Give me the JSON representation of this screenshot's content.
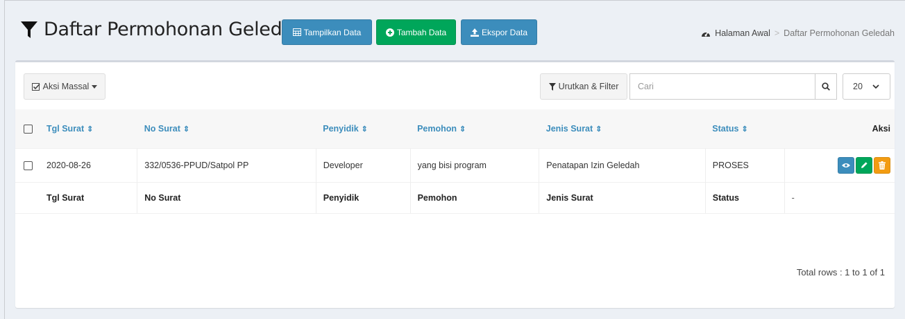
{
  "header": {
    "title": "Daftar Permohonan Geledah",
    "title_icon": "filter-icon",
    "buttons": [
      {
        "label": "Tampilkan Data",
        "icon": "table-icon",
        "color": "#3c8dbc"
      },
      {
        "label": "Tambah Data",
        "icon": "plus-circle-icon",
        "color": "#00a65a"
      },
      {
        "label": "Ekspor Data",
        "icon": "upload-icon",
        "color": "#3c8dbc"
      }
    ]
  },
  "breadcrumb": {
    "home_icon": "dashboard-icon",
    "home": "Halaman Awal",
    "separator": ">",
    "current": "Daftar Permohonan Geledah"
  },
  "toolbar": {
    "bulk_action": "Aksi Massal",
    "sort_filter": "Urutkan & Filter",
    "search_placeholder": "Cari",
    "page_size": "20"
  },
  "table": {
    "columns": [
      "Tgl Surat",
      "No Surat",
      "Penyidik",
      "Pemohon",
      "Jenis Surat",
      "Status",
      "Aksi"
    ],
    "rows": [
      {
        "tgl_surat": "2020-08-26",
        "no_surat": "332/0536-PPUD/Satpol PP",
        "penyidik": "Developer",
        "pemohon": "yang bisi program",
        "jenis_surat": "Penatapan Izin Geledah",
        "status": "PROSES",
        "actions": [
          "eye-icon",
          "pencil-icon",
          "trash-icon"
        ]
      }
    ],
    "footer": [
      "Tgl Surat",
      "No Surat",
      "Penyidik",
      "Pemohon",
      "Jenis Surat",
      "Status",
      "-"
    ]
  },
  "pagination": {
    "total": "Total rows : 1 to 1 of 1"
  },
  "colors": {
    "primary": "#3c8dbc",
    "success": "#00a65a",
    "warning": "#f39c12"
  }
}
